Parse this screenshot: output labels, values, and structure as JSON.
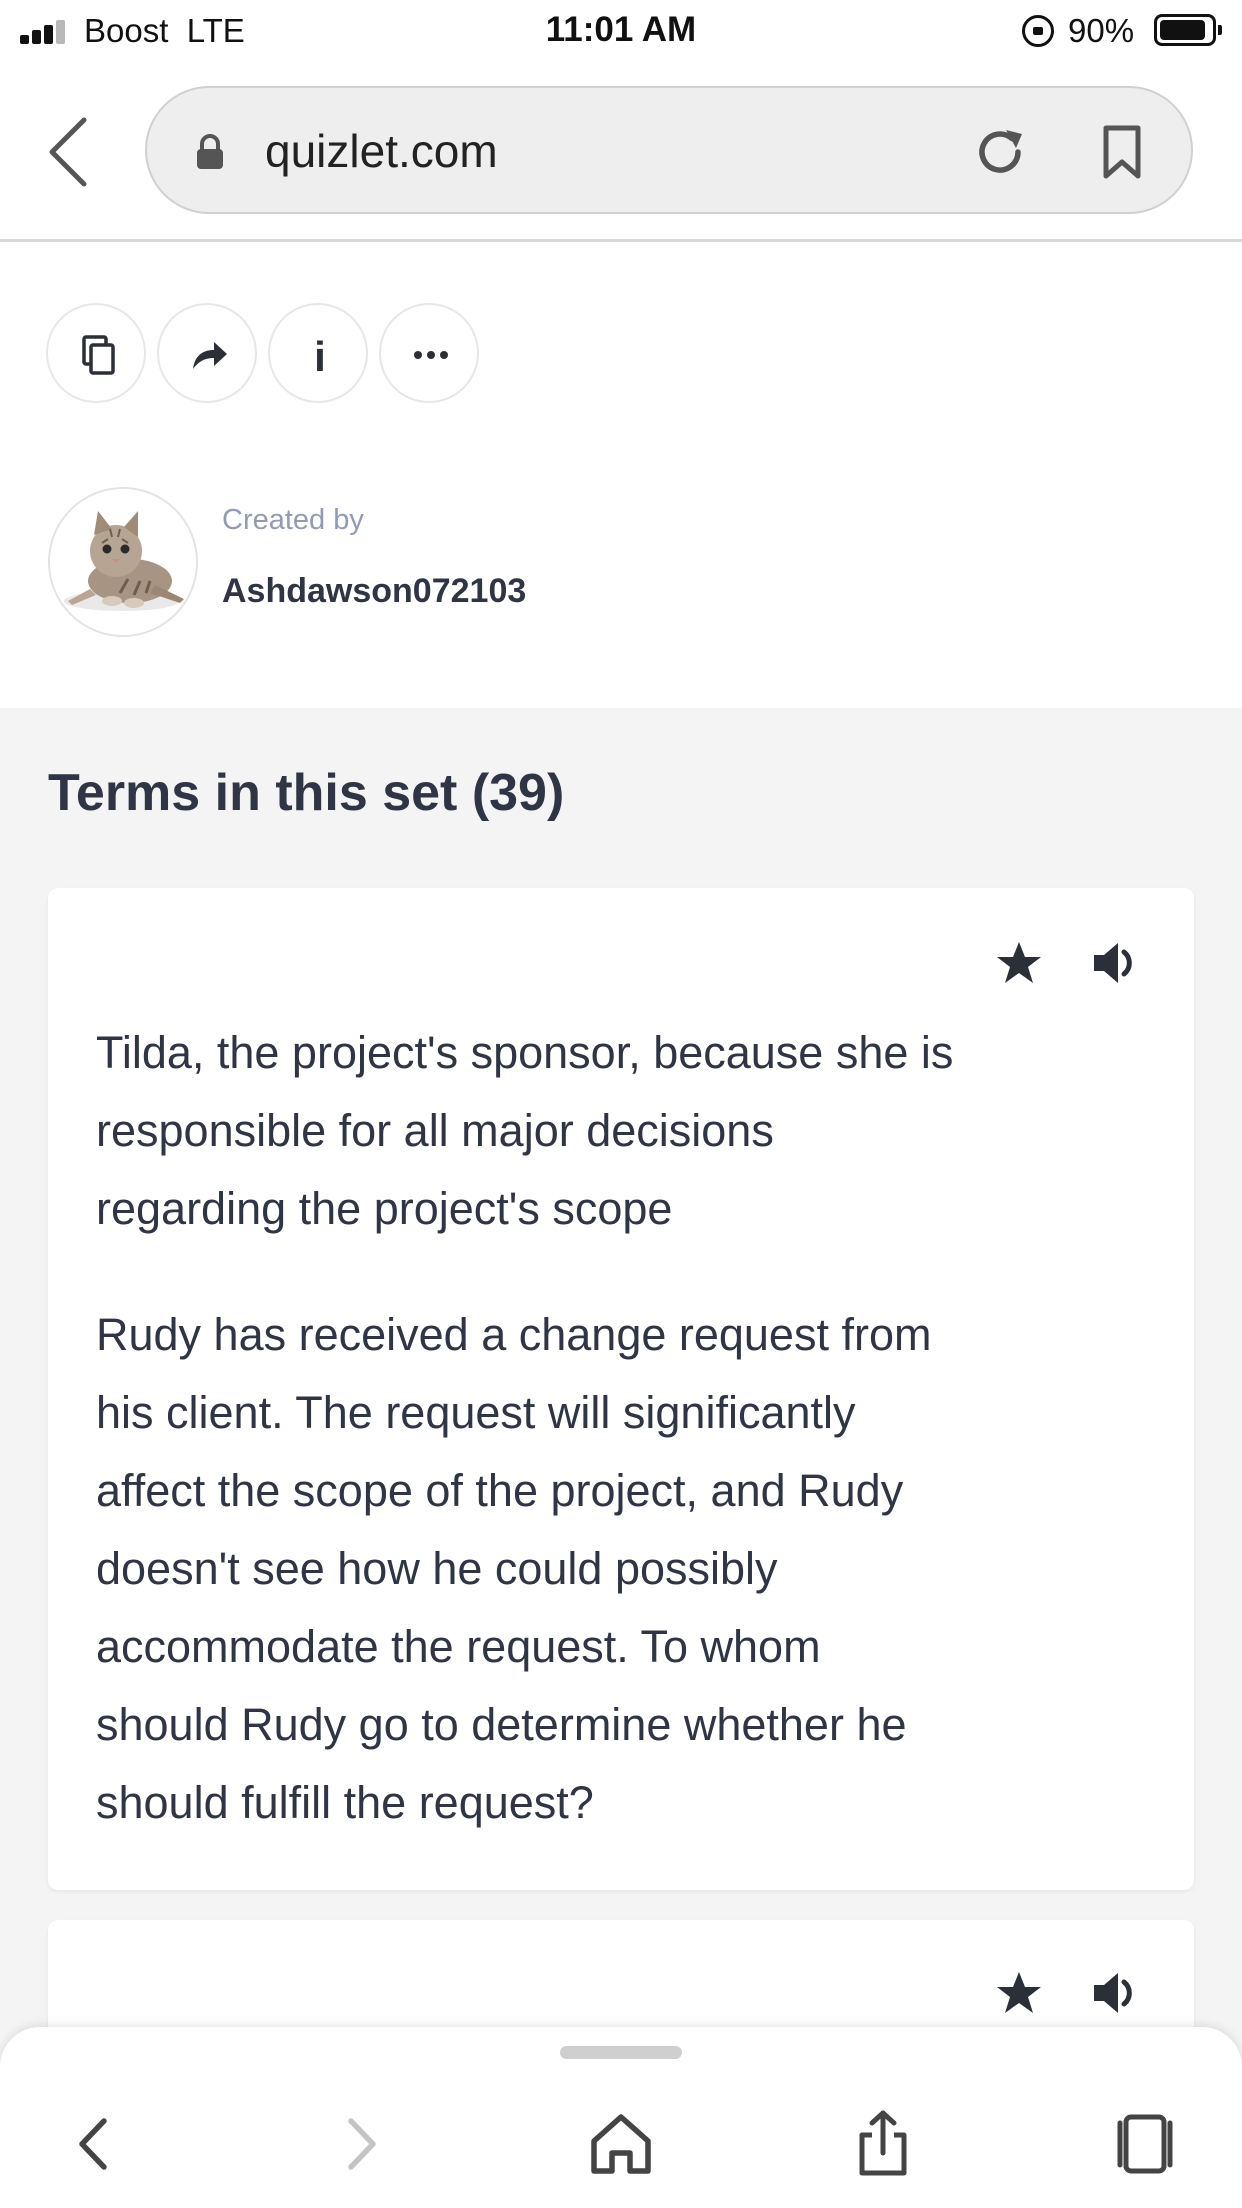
{
  "status_bar": {
    "carrier": "Boost  LTE",
    "time": "11:01 AM",
    "battery_percent": "90%",
    "battery_level": 0.9,
    "icons": [
      "signal-icon",
      "orientation-lock-icon",
      "battery-icon"
    ]
  },
  "browser": {
    "url": "quizlet.com",
    "icons": [
      "back-icon",
      "lock-icon",
      "reload-icon",
      "bookmark-icon"
    ]
  },
  "actions": {
    "icons": [
      "copy-icon",
      "share-icon",
      "info-icon",
      "more-icon"
    ],
    "info_glyph": "i",
    "more_glyph": "•••"
  },
  "creator": {
    "label": "Created by",
    "username": "Ashdawson072103"
  },
  "terms": {
    "title": "Terms in this set (39)",
    "cards": [
      {
        "definition_lines": [
          "Tilda, the project's sponsor, because she is",
          "responsible for all major decisions",
          "regarding the project's scope"
        ],
        "term_lines": [
          "Rudy has received a change request from",
          "his client. The request will significantly",
          "affect the scope of the project, and Rudy",
          "doesn't see how he could possibly",
          "accommodate the request. To whom",
          "should Rudy go to determine whether he",
          "should fulfill the request?"
        ]
      }
    ]
  },
  "toolbar": {
    "icons": [
      "back-arrow-icon",
      "forward-arrow-icon",
      "home-icon",
      "share-icon",
      "tabs-icon"
    ]
  },
  "colors": {
    "text": "#303545",
    "muted": "#939bb4",
    "section_bg": "#f4f4f4",
    "icon": "#2b2f38"
  }
}
